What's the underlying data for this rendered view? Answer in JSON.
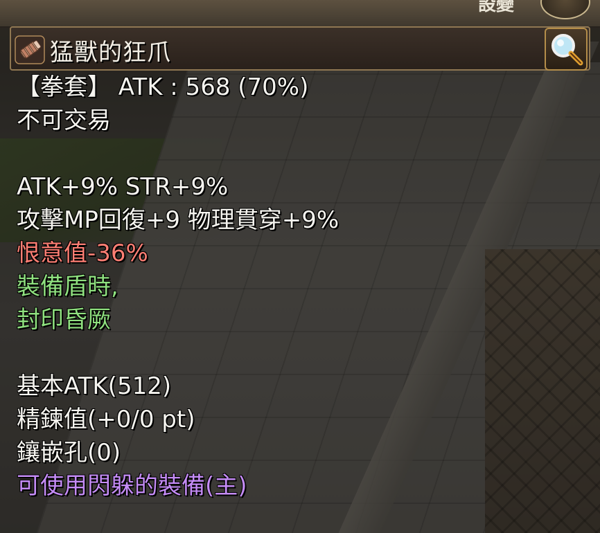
{
  "scene": {
    "corner_text": "設變"
  },
  "item": {
    "name": "猛獸的狂爪",
    "type_line": "【拳套】 ATK : 568 (70%)",
    "trade": "不可交易",
    "stats_line1": "ATK+9% STR+9%",
    "stats_line2": "攻擊MP回復+9 物理貫穿+9%",
    "hate": "恨意值-36%",
    "cond_line1": "裝備盾時,",
    "cond_line2": "封印昏厥",
    "base_atk": "基本ATK(512)",
    "refine": "精鍊值(+0/0 pt)",
    "slots": "鑲嵌孔(0)",
    "dodge": "可使用閃躲的裝備(主)"
  },
  "colors": {
    "normal": "#f5f4ef",
    "negative": "#ff7f74",
    "condition": "#8fe07f",
    "special": "#c58cf6",
    "frame": "#8f7752"
  },
  "icons": {
    "item": "glove-icon",
    "inspect": "magnifier-icon"
  }
}
